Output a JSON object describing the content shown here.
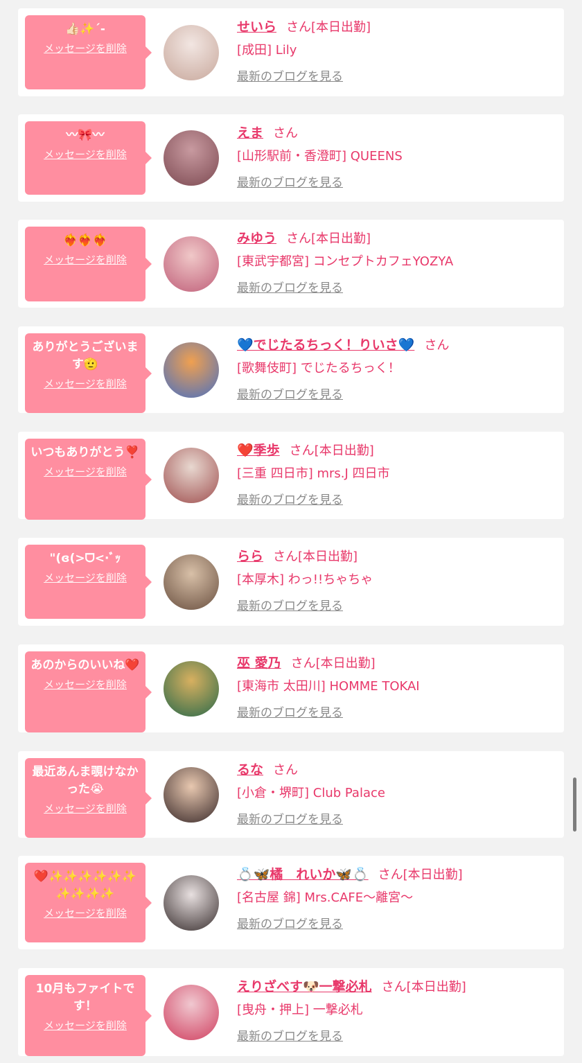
{
  "colors": {
    "accent": "#e8386a",
    "bubble": "#ff8ea0",
    "background": "#f2f2f2"
  },
  "cards": [
    {
      "message": "👍🏻✨´-",
      "delete_label": "メッセージを削除",
      "name": "せいら",
      "honorific": "さん",
      "work_status": "[本日出勤]",
      "shop": "[成田] Lily",
      "blog_label": "最新のブログを見る",
      "avatar_colors": [
        "#f2e6e2",
        "#c8a89c"
      ]
    },
    {
      "message": "〰🎀〰",
      "delete_label": "メッセージを削除",
      "name": "えま",
      "honorific": "さん",
      "work_status": "",
      "shop": "[山形駅前・香澄町] QUEENS",
      "blog_label": "最新のブログを見る",
      "avatar_colors": [
        "#c89aa0",
        "#7d4a52"
      ]
    },
    {
      "message": "❤️‍🔥❤️‍🔥❤️‍🔥",
      "delete_label": "メッセージを削除",
      "name": "みゆう",
      "honorific": "さん",
      "work_status": "[本日出勤]",
      "shop": "[東武宇都宮] コンセプトカフェYOZYA",
      "blog_label": "最新のブログを見る",
      "avatar_colors": [
        "#f0c8c8",
        "#c0607a"
      ]
    },
    {
      "message": "ありがとうございます🫡",
      "delete_label": "メッセージを削除",
      "name": "💙でじたるちっく！りいさ💙",
      "honorific": "さん",
      "work_status": "",
      "shop": "[歌舞伎町] でじたるちっく！",
      "blog_label": "最新のブログを見る",
      "avatar_colors": [
        "#f0a050",
        "#4a70c0"
      ]
    },
    {
      "message": "いつもありがとう❣️",
      "delete_label": "メッセージを削除",
      "name": "❤️季歩",
      "honorific": "さん",
      "work_status": "[本日出勤]",
      "shop": "[三重 四日市] mrs.J 四日市",
      "blog_label": "最新のブログを見る",
      "avatar_colors": [
        "#e8d8d0",
        "#a05050"
      ]
    },
    {
      "message": "\"(ɞ(>ᗜ<·ﾞｯ",
      "delete_label": "メッセージを削除",
      "name": "らら",
      "honorific": "さん",
      "work_status": "[本日出勤]",
      "shop": "[本厚木] わっ!!ちゃちゃ",
      "blog_label": "最新のブログを見る",
      "avatar_colors": [
        "#d8c0a8",
        "#6a5040"
      ]
    },
    {
      "message": "あのからのいいね❤️",
      "delete_label": "メッセージを削除",
      "name": "巫 愛乃",
      "honorific": "さん",
      "work_status": "[本日出勤]",
      "shop": "[東海市 太田川] HOMME TOKAI",
      "blog_label": "最新のブログを見る",
      "avatar_colors": [
        "#d8b060",
        "#2a6a4a"
      ]
    },
    {
      "message": "最近あんま覗けなかった😭",
      "delete_label": "メッセージを削除",
      "name": "るな",
      "honorific": "さん",
      "work_status": "",
      "shop": "[小倉・堺町] Club Palace",
      "blog_label": "最新のブログを見る",
      "avatar_colors": [
        "#e8c8b0",
        "#3a2a2a"
      ]
    },
    {
      "message": "❤️✨✨✨✨✨✨✨✨✨✨",
      "delete_label": "メッセージを削除",
      "name": "💍🦋橘　れいか🦋💍",
      "honorific": "さん",
      "work_status": "[本日出勤]",
      "shop": "[名古屋 錦] Mrs.CAFE〜離宮〜",
      "blog_label": "最新のブログを見る",
      "avatar_colors": [
        "#e8e0e0",
        "#3a3030"
      ]
    },
    {
      "message": "10月もファイトです！",
      "delete_label": "メッセージを削除",
      "name": "えりざべす🐶一撃必札",
      "honorific": "さん",
      "work_status": "[本日出勤]",
      "shop": "[曳舟・押上] 一撃必札",
      "blog_label": "最新のブログを見る",
      "avatar_colors": [
        "#f0c8d0",
        "#d04060"
      ]
    }
  ]
}
